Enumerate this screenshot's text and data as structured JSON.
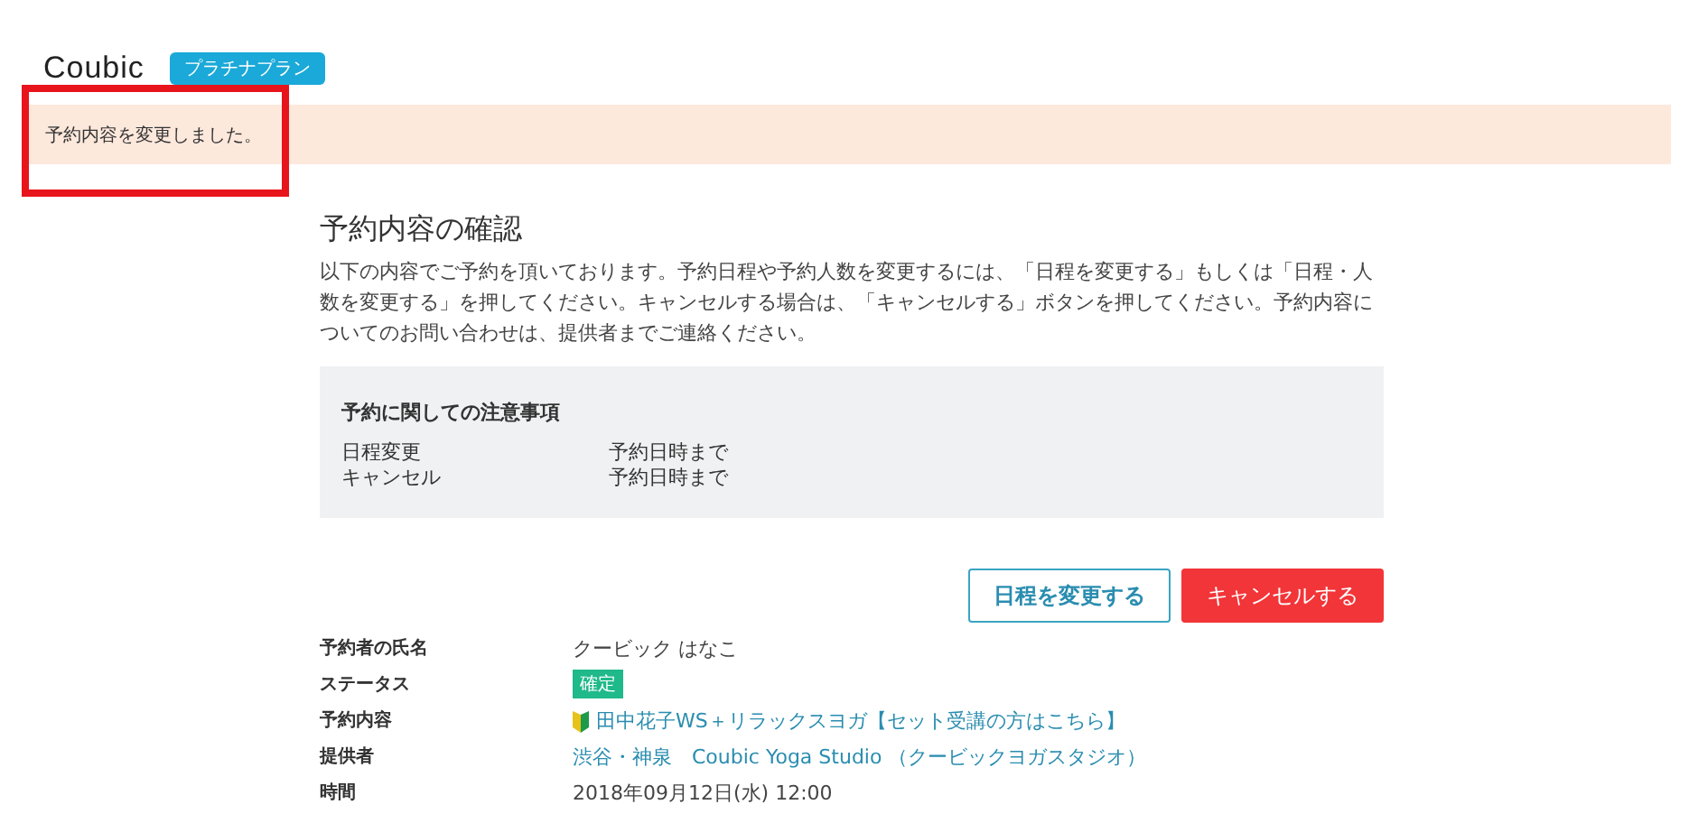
{
  "header": {
    "logo": "Coubic",
    "plan_badge": "プラチナプラン"
  },
  "notice": {
    "text": "予約内容を変更しました。",
    "highlighted": true
  },
  "title": "予約内容の確認",
  "description": "以下の内容でご予約を頂いております。予約日程や予約人数を変更するには、「日程を変更する」もしくは「日程・人数を変更する」を押してください。キャンセルする場合は、「キャンセルする」ボタンを押してください。予約内容についてのお問い合わせは、提供者までご連絡ください。",
  "notes": {
    "heading": "予約に関しての注意事項",
    "rows": [
      {
        "label": "日程変更",
        "value": "予約日時まで"
      },
      {
        "label": "キャンセル",
        "value": "予約日時まで"
      }
    ]
  },
  "buttons": [
    {
      "label": "日程を変更する",
      "kind": "outline"
    },
    {
      "label": "キャンセルする",
      "kind": "danger"
    }
  ],
  "details": [
    {
      "label": "予約者の氏名",
      "value": "クービック はなこ",
      "kind": "text"
    },
    {
      "label": "ステータス",
      "value": "確定",
      "kind": "badge"
    },
    {
      "label": "予約内容",
      "value": "田中花子WS＋リラックスヨガ【セット受講の方はこちら】",
      "kind": "beginner-link"
    },
    {
      "label": "提供者",
      "value": "渋谷・神泉　Coubic Yoga Studio （クービックヨガスタジオ）",
      "kind": "link"
    },
    {
      "label": "時間",
      "value": "2018年09月12日(水) 12:00",
      "kind": "text"
    }
  ]
}
